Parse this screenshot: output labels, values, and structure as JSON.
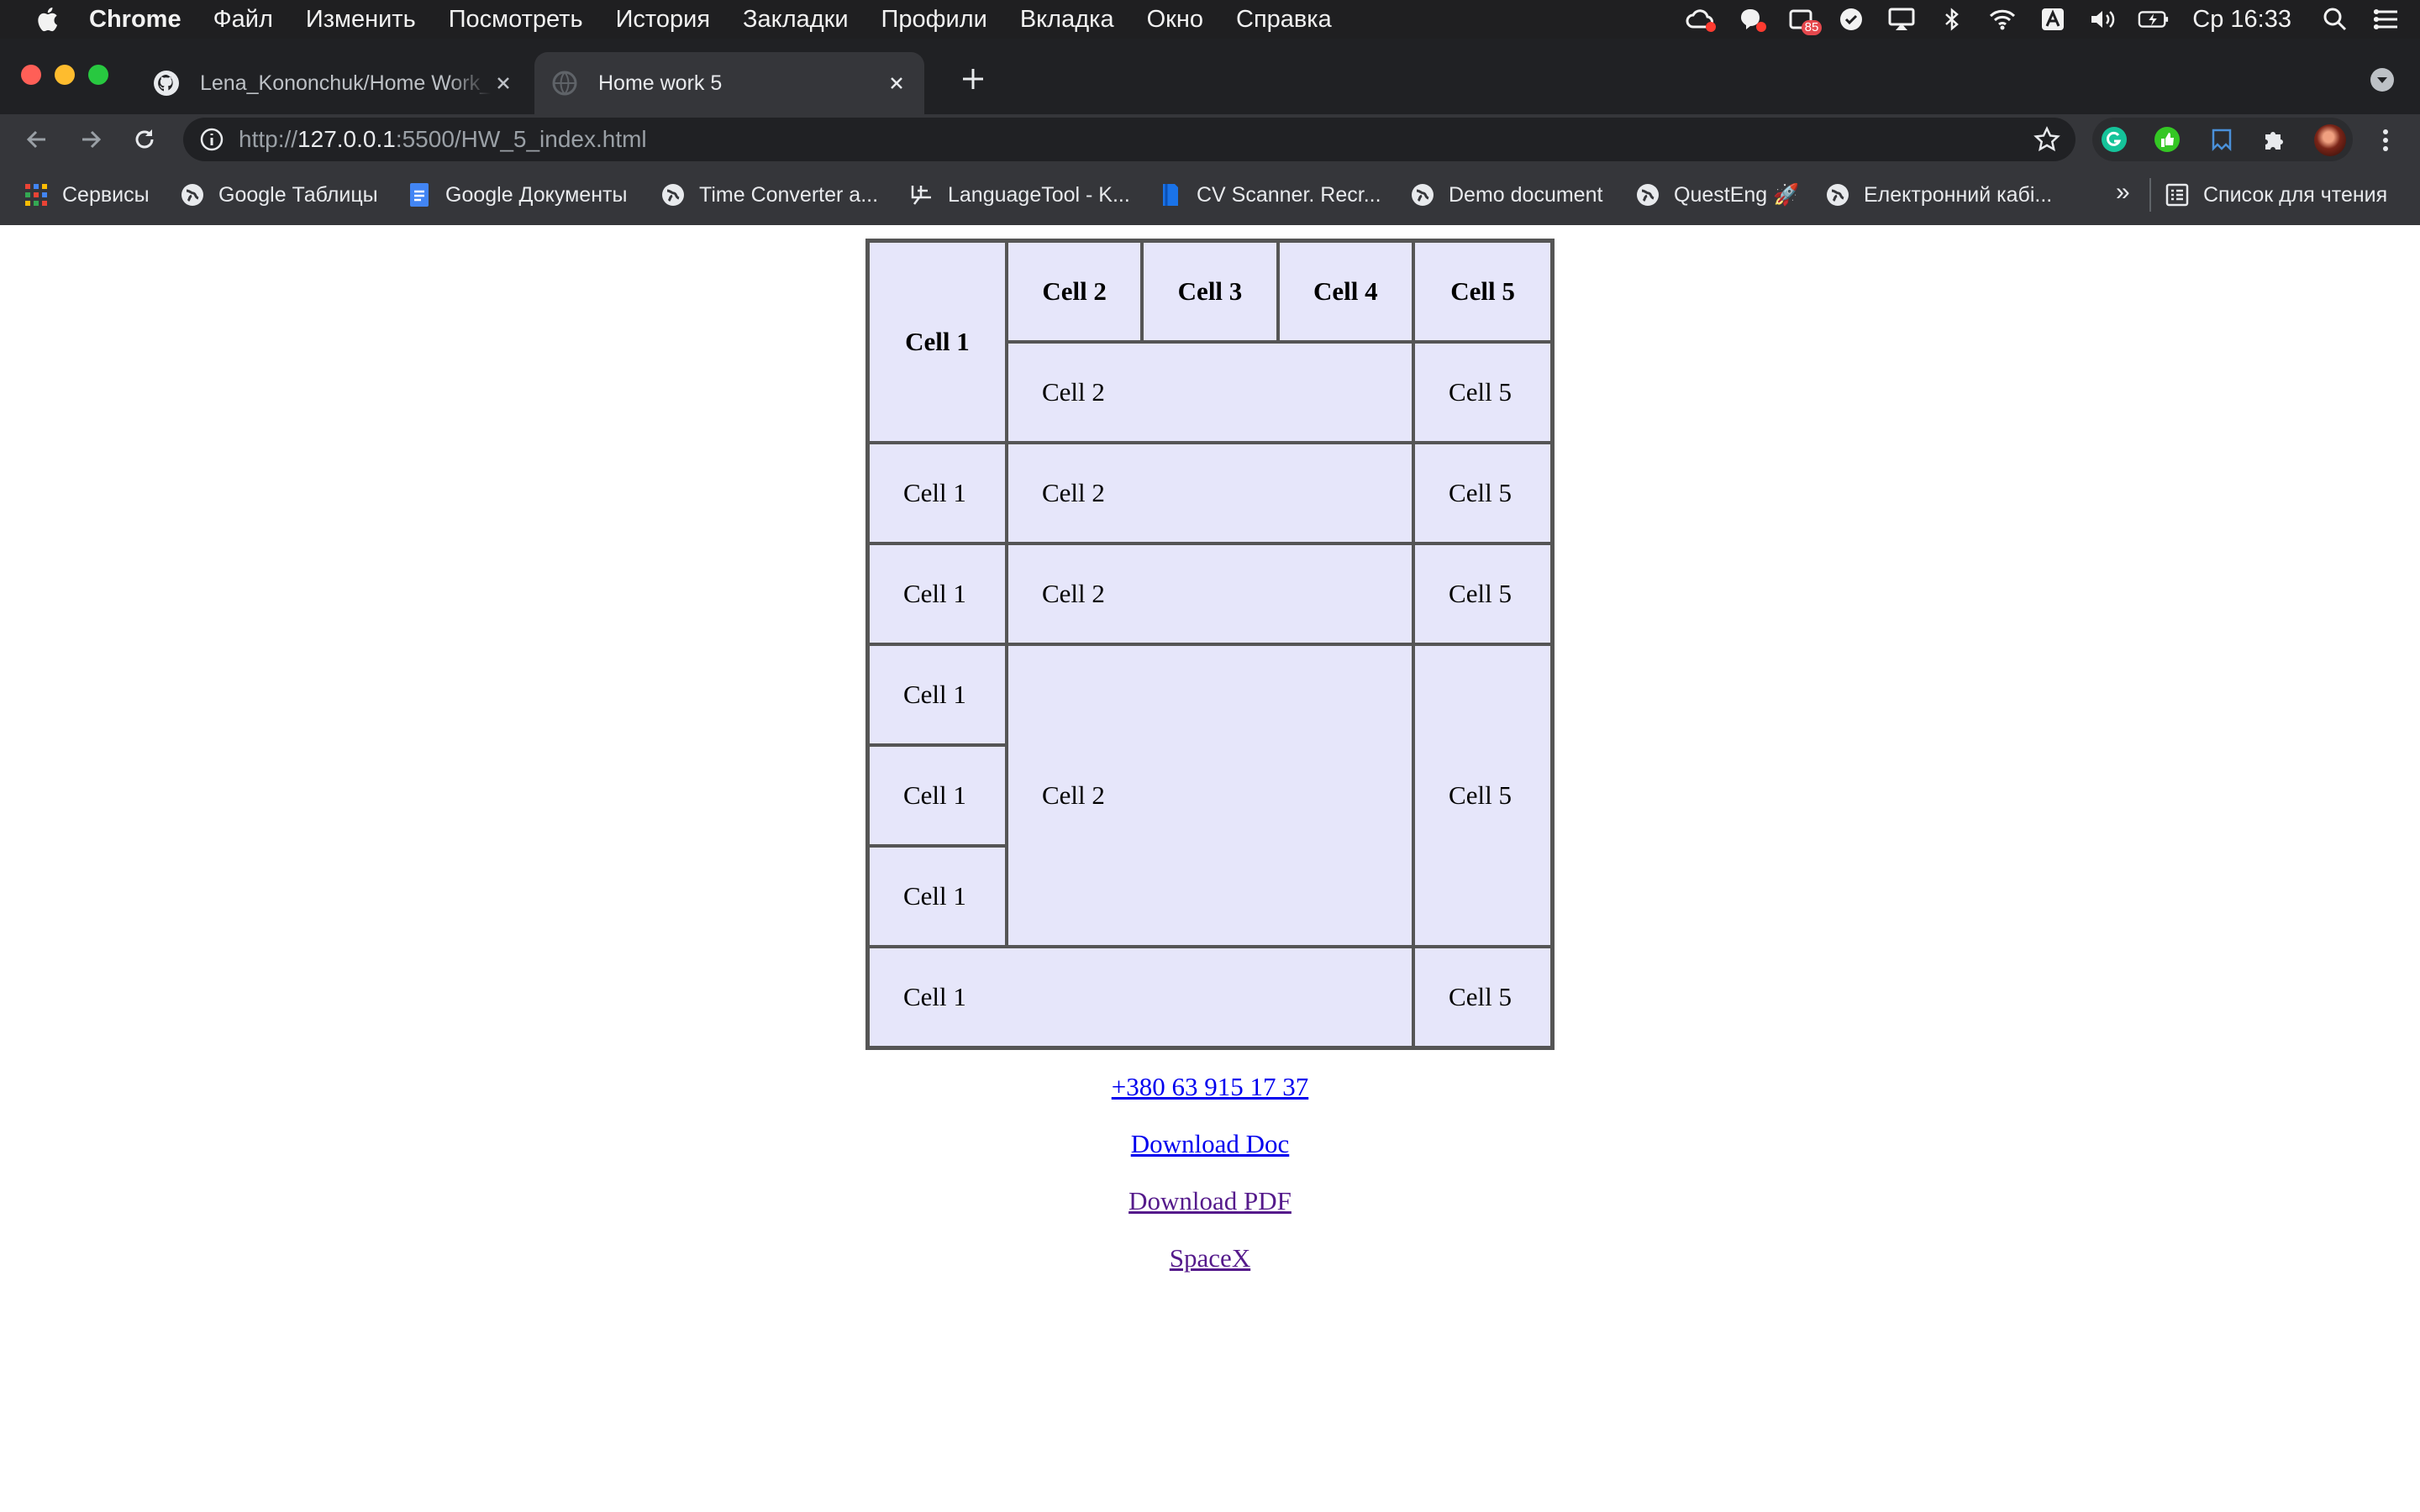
{
  "menubar": {
    "app_name": "Chrome",
    "items": [
      "Файл",
      "Изменить",
      "Посмотреть",
      "История",
      "Закладки",
      "Профили",
      "Вкладка",
      "Окно",
      "Справка"
    ],
    "badge_count": "85",
    "clock": "Ср 16:33"
  },
  "tabs": [
    {
      "title": "Lena_Kononchuk/Home Work_5",
      "active": false
    },
    {
      "title": "Home work 5",
      "active": true
    }
  ],
  "toolbar": {
    "url_scheme": "http://",
    "url_host": "127.0.0.1",
    "url_rest": ":5500/HW_5_index.html"
  },
  "bookmarks": [
    {
      "label": "Сервисы",
      "icon": "apps-grid-icon"
    },
    {
      "label": "Google Таблицы",
      "icon": "globe-icon"
    },
    {
      "label": "Google Документы",
      "icon": "google-docs-icon"
    },
    {
      "label": "Time Converter a...",
      "icon": "globe-icon"
    },
    {
      "label": "LanguageTool - K...",
      "icon": "languagetool-icon"
    },
    {
      "label": "CV Scanner. Recr...",
      "icon": "cv-scanner-icon"
    },
    {
      "label": "Demo document",
      "icon": "globe-icon"
    },
    {
      "label": "QuestEng 🚀",
      "icon": "globe-icon"
    },
    {
      "label": "Електронний кабі...",
      "icon": "globe-icon"
    }
  ],
  "bookmarks_overflow": "»",
  "reading_list": "Список для чтения",
  "table": {
    "header": {
      "c1": "Cell 1",
      "c2": "Cell 2",
      "c3": "Cell 3",
      "c4": "Cell 4",
      "c5": "Cell 5"
    },
    "cell1": "Cell 1",
    "cell2": "Cell 2",
    "cell5": "Cell 5"
  },
  "links": {
    "phone": "+380 63 915 17 37",
    "doc": "Download Doc",
    "pdf": "Download PDF",
    "spacex": "SpaceX"
  },
  "colors": {
    "table_bg": "#e6e6fa",
    "link_unvisited": "#0000ee",
    "link_visited": "#551a8b"
  }
}
